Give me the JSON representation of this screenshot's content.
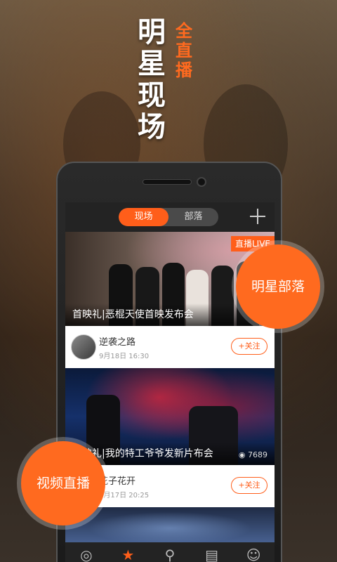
{
  "promo": {
    "headline": "明星现场",
    "headline_sub": "全直播"
  },
  "app": {
    "tabs": [
      {
        "label": "现场",
        "active": true
      },
      {
        "label": "部落",
        "active": false
      }
    ],
    "add_icon": "plus-icon"
  },
  "feed": [
    {
      "live_badge": "直播LIVE",
      "caption": "首映礼|恶棍天使首映发布会",
      "views": "",
      "user": "逆袭之路",
      "date": "9月18日  16:30",
      "follow": "+关注"
    },
    {
      "live_badge": "",
      "caption": "首映礼|我的特工爷爷发新片布会",
      "views": "7689",
      "user": "花子花开",
      "date": "9月17日  20:25",
      "follow": "+关注"
    }
  ],
  "navbar": [
    {
      "label": "新片",
      "icon": "film-reel-icon",
      "glyph": "◎",
      "active": false
    },
    {
      "label": "明星",
      "icon": "star-icon",
      "glyph": "★",
      "active": true
    },
    {
      "label": "发现",
      "icon": "search-icon",
      "glyph": "⚲",
      "active": false
    },
    {
      "label": "消息",
      "icon": "message-icon",
      "glyph": "▤",
      "active": false
    },
    {
      "label": "我的",
      "icon": "person-icon",
      "glyph": "☺",
      "active": false
    }
  ],
  "bubbles": {
    "tribe": "明星部落",
    "live_video": "视频直播"
  },
  "colors": {
    "accent": "#ff5e1a",
    "bar": "#232323"
  }
}
